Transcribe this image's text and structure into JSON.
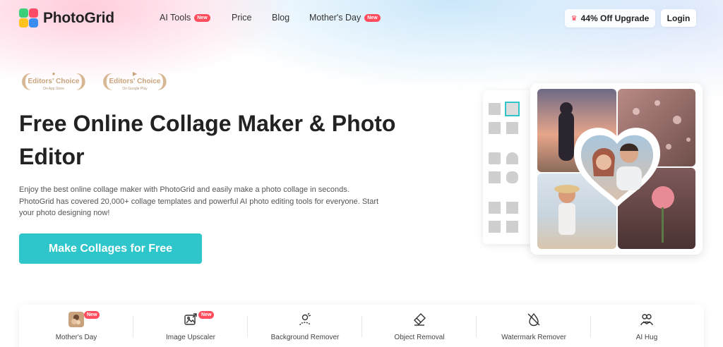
{
  "header": {
    "brand": "PhotoGrid",
    "nav": [
      {
        "label": "AI Tools",
        "badge": "New"
      },
      {
        "label": "Price"
      },
      {
        "label": "Blog"
      },
      {
        "label": "Mother's Day",
        "badge": "New"
      }
    ],
    "upgrade_label": "44% Off Upgrade",
    "login_label": "Login"
  },
  "badges": [
    {
      "title": "Editors' Choice",
      "sub": "On App Store",
      "store_icon": "apple-icon"
    },
    {
      "title": "Editors' Choice",
      "sub": "On Google Play",
      "store_icon": "google-play-icon"
    }
  ],
  "hero": {
    "title": "Free Online Collage Maker & Photo Editor",
    "description": "Enjoy the best online collage maker with PhotoGrid and easily make a photo collage in seconds. PhotoGrid has covered 20,000+ collage templates and powerful AI photo editing tools for everyone. Start your photo designing now!",
    "cta_label": "Make Collages for Free"
  },
  "tools": [
    {
      "label": "Mother's Day",
      "badge": "New",
      "icon": "mothers-day-thumbnail"
    },
    {
      "label": "Image Upscaler",
      "badge": "New",
      "icon": "image-upscale-icon"
    },
    {
      "label": "Background Remover",
      "icon": "person-cutout-icon"
    },
    {
      "label": "Object Removal",
      "icon": "eraser-icon"
    },
    {
      "label": "Watermark Remover",
      "icon": "watermark-remove-icon"
    },
    {
      "label": "AI Hug",
      "icon": "hug-icon"
    }
  ],
  "colors": {
    "accent": "#2ec5cb",
    "new_badge": "#ff4d5e",
    "badge_gold": "#c9a47c",
    "crown": "#ff3b4f"
  }
}
